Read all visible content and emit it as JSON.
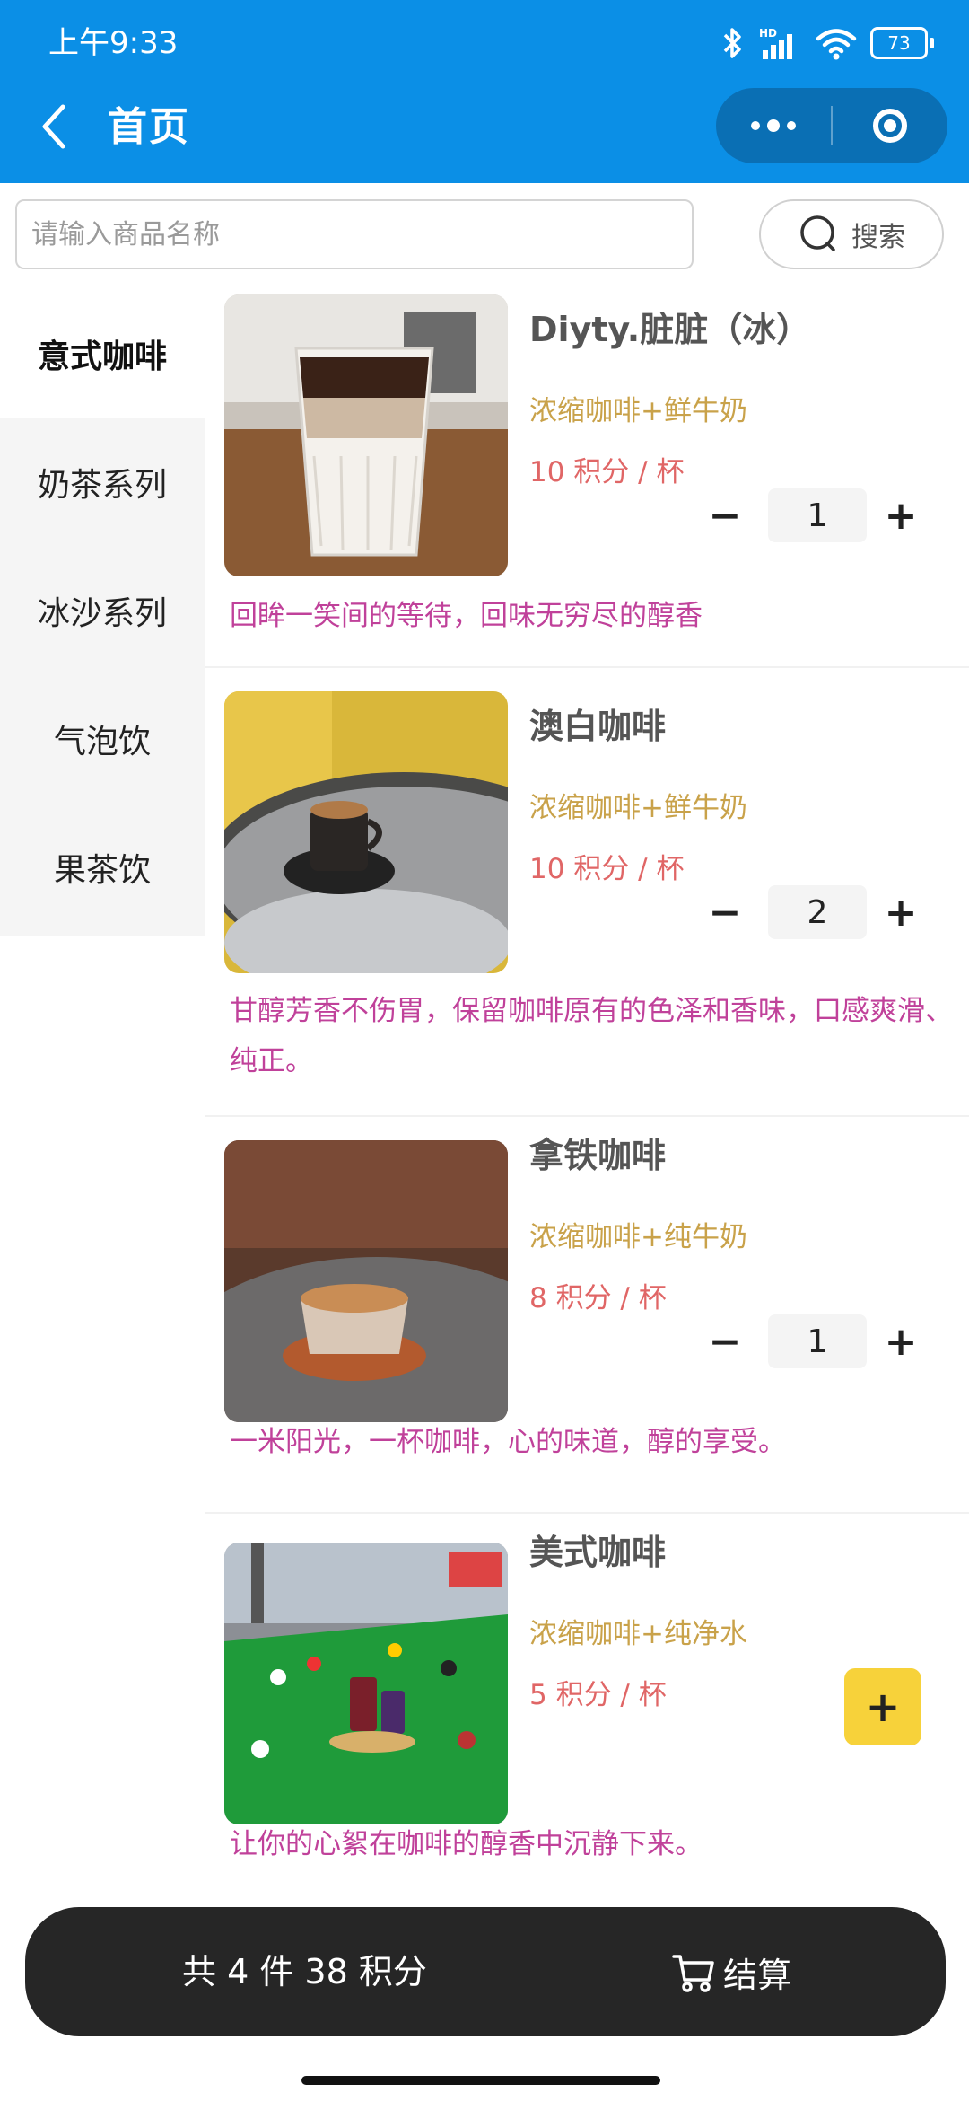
{
  "status_bar": {
    "time": "上午9:33",
    "battery": "73"
  },
  "nav": {
    "title": "首页"
  },
  "search": {
    "placeholder": "请输入商品名称",
    "value": "",
    "button_label": "搜索"
  },
  "categories": [
    "意式咖啡",
    "奶茶系列",
    "冰沙系列",
    "气泡饮",
    "果茶饮"
  ],
  "active_category": "意式咖啡",
  "products": [
    {
      "name": "Diyty.脏脏（冰）",
      "ingredients": "浓缩咖啡+鲜牛奶",
      "price": "10 积分 / 杯",
      "quantity": "1",
      "slogan": "回眸一笑间的等待，回味无穷尽的醇香"
    },
    {
      "name": "澳白咖啡",
      "ingredients": "浓缩咖啡+鲜牛奶",
      "price": "10 积分 / 杯",
      "quantity": "2",
      "slogan": "甘醇芳香不伤胃，保留咖啡原有的色泽和香味，口感爽滑、纯正。"
    },
    {
      "name": "拿铁咖啡",
      "ingredients": "浓缩咖啡+纯牛奶",
      "price": "8 积分 / 杯",
      "quantity": "1",
      "slogan": "一米阳光，一杯咖啡，心的味道，醇的享受。"
    },
    {
      "name": "美式咖啡",
      "ingredients": "浓缩咖啡+纯净水",
      "price": "5 积分 / 杯",
      "quantity": "",
      "slogan": "让你的心絮在咖啡的醇香中沉静下来。"
    }
  ],
  "stepper": {
    "minus": "−",
    "plus": "+"
  },
  "cart": {
    "total_label": "共 4 件 38 积分",
    "checkout_label": "结算"
  },
  "colors": {
    "header": "#0b8fe6",
    "ingredients": "#c9a24a",
    "price": "#e06666",
    "slogan": "#c0419a",
    "add_button": "#f7d23a",
    "checkout_bar": "#262626"
  }
}
